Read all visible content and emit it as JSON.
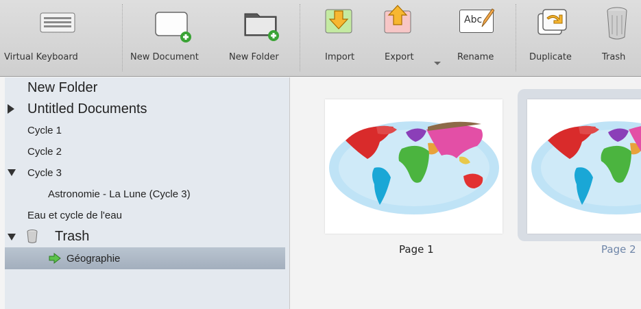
{
  "toolbar": {
    "virtual_keyboard": "Virtual Keyboard",
    "new_document": "New Document",
    "new_folder": "New Folder",
    "import": "Import",
    "export": "Export",
    "rename": "Rename",
    "rename_icon_text": "Abc",
    "duplicate": "Duplicate",
    "trash": "Trash"
  },
  "sidebar": {
    "items": [
      {
        "label": "New Folder"
      },
      {
        "label": "Untitled Documents"
      },
      {
        "label": "Cycle 1"
      },
      {
        "label": "Cycle 2"
      },
      {
        "label": "Cycle 3"
      },
      {
        "label": "Astronomie - La Lune (Cycle 3)"
      },
      {
        "label": "Eau et cycle de l'eau"
      },
      {
        "label": "Trash"
      },
      {
        "label": "Géographie"
      }
    ]
  },
  "pages": [
    {
      "label": "Page 1"
    },
    {
      "label": "Page 2"
    }
  ],
  "colors": {
    "toolbar_bg": "#d6d6d6",
    "sidebar_bg": "#e4e9ef",
    "selection": "#a9b5c3",
    "selected_page_caption": "#6f86a8"
  }
}
